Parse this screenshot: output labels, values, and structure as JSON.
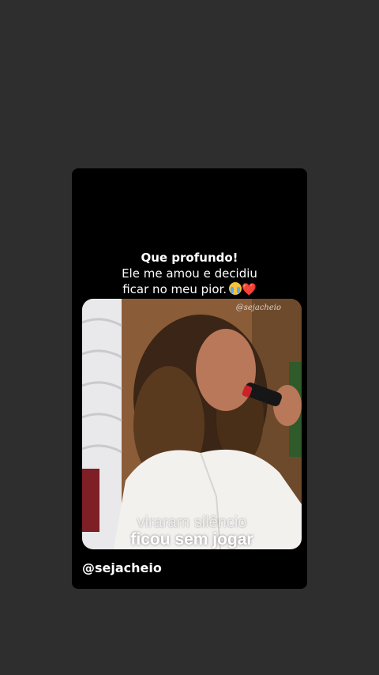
{
  "caption": {
    "title": "Que profundo!",
    "line1": "Ele me amou e decidiu",
    "line2": "ficar no meu pior.",
    "emojis": [
      "loudly-crying-face",
      "red-heart"
    ],
    "heart": "❤️"
  },
  "video": {
    "watermark": "@sejacheio",
    "subtitle_top": "viraram silêncio",
    "subtitle_bottom": "ficou sem jogar"
  },
  "footer": {
    "handle": "@sejacheio"
  },
  "colors": {
    "background": "#2e2e2e",
    "card": "#000000",
    "text": "#ffffff",
    "heart": "#e0222c"
  }
}
